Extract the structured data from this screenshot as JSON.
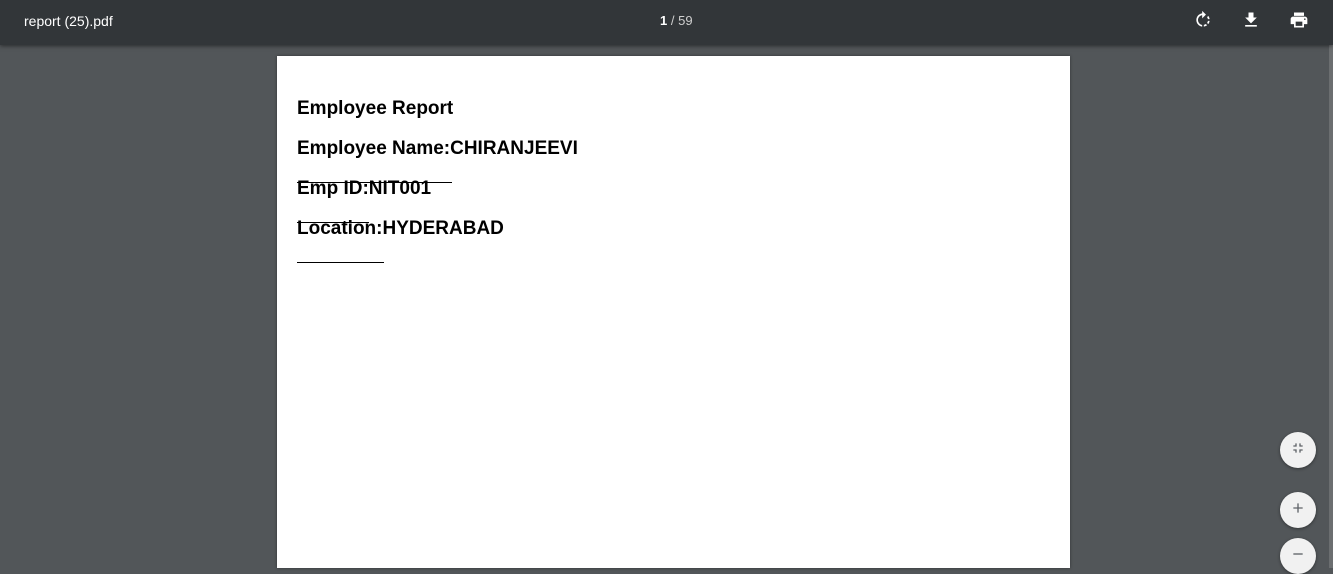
{
  "toolbar": {
    "title": "report (25).pdf",
    "page_current": "1",
    "page_separator": "/",
    "page_total": "59",
    "icons": {
      "rotate": "rotate-icon",
      "download": "download-icon",
      "print": "print-icon"
    }
  },
  "document": {
    "title": "Employee Report",
    "name_line": "Employee Name:CHIRANJEEVI",
    "id_line": "Emp ID:NIT001",
    "location_line": "Location:HYDERABAD"
  },
  "controls": {
    "fit_icon": "fit-to-page-icon",
    "zoom_in_icon": "zoom-in-icon",
    "zoom_out_icon": "zoom-out-icon"
  },
  "colors": {
    "toolbar_bg": "#323639",
    "viewer_bg": "#525659",
    "page_bg": "#ffffff"
  }
}
